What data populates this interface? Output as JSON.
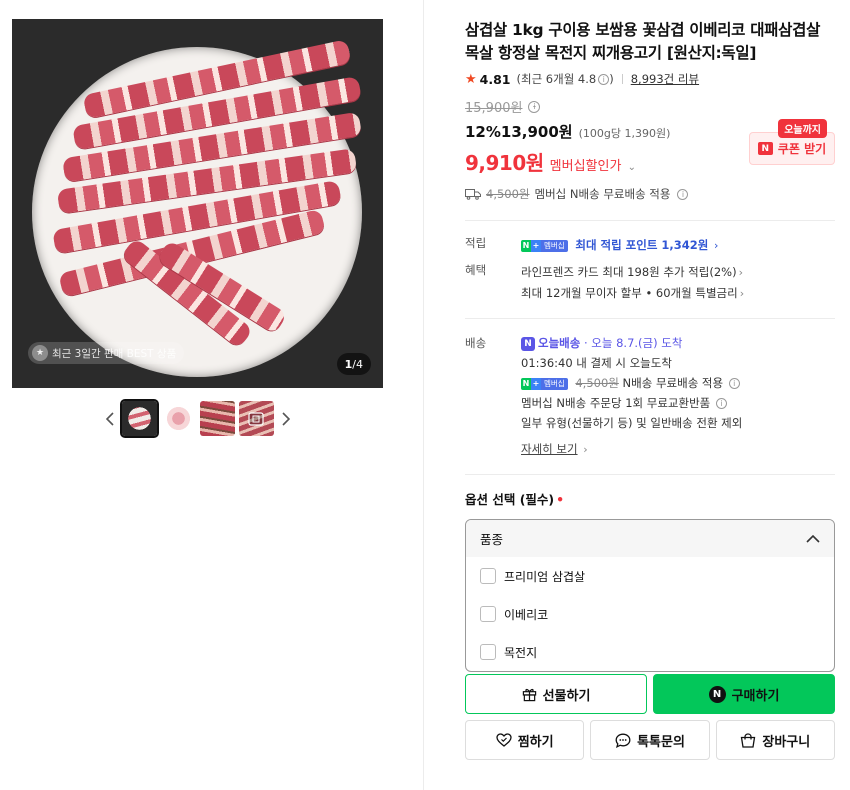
{
  "gallery": {
    "badge_text": "최근 3일간 판매 BEST 상품",
    "counter_current": "1",
    "counter_total": "/4",
    "prev_label": "‹",
    "next_label": "›",
    "thumbnails": [
      "thumb-1",
      "thumb-2",
      "thumb-3",
      "thumb-4"
    ]
  },
  "product": {
    "title": "삼겹살 1kg 구이용 보쌈용 꽃삼겹 이베리코 대패삼겹살 목살 항정살 목전지 찌개용고기 [원산지:독일]",
    "rating": "4.81",
    "rating_recent": "(최근 6개월 4.8",
    "rating_recent_close": ")",
    "reviews": "8,993건 리뷰",
    "original_price": "15,900원",
    "discount": "12%",
    "sale_price": "13,900원",
    "unit_price": "(100g당 1,390원)",
    "member_price": "9,910원",
    "member_label": "멤버십할인가",
    "coupon_tag": "오늘까지",
    "coupon_label": "쿠폰 받기",
    "shipping_strike": "4,500원",
    "shipping_text": "멤버십 N배송 무료배송 적용"
  },
  "benefits": {
    "points_label": "적립",
    "points_badge": "멤버십",
    "points_text": "최대 적립 포인트 1,342원",
    "perks_label": "혜택",
    "perk_1": "라인프렌즈 카드 최대 198원 추가 적립(2%)",
    "perk_2": "최대 12개월 무이자 할부 • 60개월 특별금리"
  },
  "delivery": {
    "label": "배송",
    "today_name": "오늘배송",
    "today_date": "· 오늘 8.7.(금) 도착",
    "cutoff": "01:36:40 내 결제 시 오늘도착",
    "membership_badge": "멤버십",
    "fee_strike": "4,500원",
    "fee_text": "N배송 무료배송 적용",
    "exchange": "멤버십 N배송 주문당 1회 무료교환반품",
    "note": "일부 유형(선물하기 등) 및 일반배송 전환 제외",
    "details_link": "자세히 보기"
  },
  "options": {
    "label": "옵션 선택 (필수)",
    "required_mark": "•",
    "select_title": "품종",
    "items": [
      "프리미엄 삼겹살",
      "이베리코",
      "목전지"
    ]
  },
  "actions": {
    "gift": "선물하기",
    "buy": "구매하기",
    "wish": "찜하기",
    "talk": "톡톡문의",
    "cart": "장바구니"
  },
  "colors": {
    "accent_red": "#f0333c",
    "naver_green": "#03c75a",
    "delivery_purple": "#5a55e6",
    "point_blue": "#3156d4"
  }
}
